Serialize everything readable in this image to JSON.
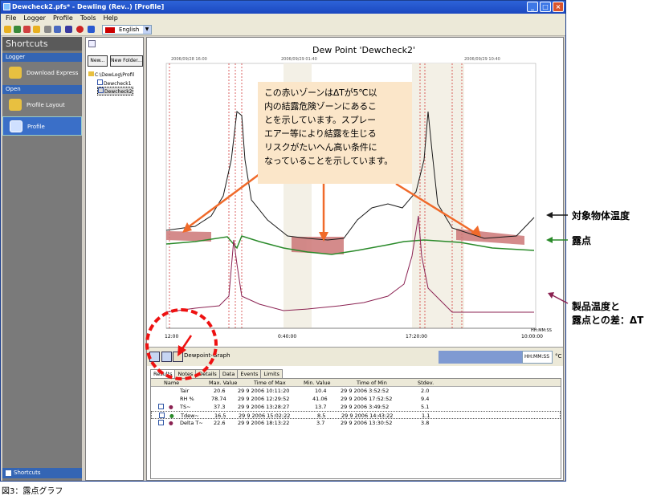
{
  "window": {
    "title": "Dewcheck2.pfs* - Dewling (Rev..) [Profile]"
  },
  "menu": [
    "File",
    "Logger",
    "Profile",
    "Tools",
    "Help"
  ],
  "toolbar": {
    "language": "English"
  },
  "shortcuts": {
    "header": "Shortcuts",
    "sections": [
      {
        "title": "Logger",
        "items": [
          "Download Express"
        ]
      },
      {
        "title": "Open",
        "items": [
          "Profile Layout",
          "Profile"
        ]
      }
    ],
    "footer": "Shortcuts"
  },
  "tree": {
    "new_button": "New...",
    "new_folder_button": "New Folder...",
    "root": "C:\\DewLog\\Profil",
    "children": [
      "Dewcheck1",
      "Dewcheck2"
    ]
  },
  "chart": {
    "title": "Dew Point 'Dewcheck2'",
    "dates": [
      "2006/09/28 16:00",
      "2006/09/29 01:40",
      "2006/09/29 10:40"
    ],
    "x_ticks": [
      "12:00",
      "0:40:00",
      "17:20:00",
      "10:00:00"
    ],
    "x_unit": "HH:MM:SS"
  },
  "callout": {
    "lines": [
      "この赤いゾーンはΔTが5℃以",
      "内の結露危険ゾーンにあるこ",
      "とを示しています。スプレー",
      "エアー等により結露を生じる",
      "リスクがたいへん高い条件に",
      "なっていることを示しています。"
    ]
  },
  "graph_toolbar": {
    "label": "Dewpoint-Graph",
    "format": "HH:MM:SS",
    "unit": "°C"
  },
  "tabs": [
    "Results",
    "Notes",
    "Details",
    "Data",
    "Events",
    "Limits"
  ],
  "table": {
    "headers": [
      "Name",
      "Max. Value",
      "Time of Max",
      "Min. Value",
      "Time of Min",
      "Stdev."
    ],
    "rows": [
      [
        "Tair",
        "20.6",
        "29 9 2006 10:11:20",
        "10.4",
        "29 9 2006 3:52:52",
        "2.0"
      ],
      [
        "RH %",
        "78.74",
        "29 9 2006 12:29:52",
        "41.06",
        "29 9 2006 17:52:52",
        "9.4"
      ],
      [
        "TS~",
        "37.3",
        "29 9 2006 13:28:27",
        "13.7",
        "29 9 2006 3:49:52",
        "5.1"
      ],
      [
        "Tdew~",
        "16.5",
        "29 9 2006 15:02:22",
        "8.5",
        "29 9 2006 14:43:22",
        "1.1"
      ],
      [
        "Delta T~",
        "22.6",
        "29 9 2006 18:13:22",
        "3.7",
        "29 9 2006 13:30:52",
        "3.8"
      ]
    ]
  },
  "legend_labels": {
    "surface": "対象物体温度",
    "dewpoint": "露点",
    "delta_line1": "製品温度と",
    "delta_line2": "露点との差：ΔT"
  },
  "caption": "図3：露点グラフ",
  "colors": {
    "surface": "#1a1a1a",
    "dewpoint": "#2a8a2a",
    "delta": "#8b2252",
    "callout_bg": "#fbe6c9",
    "arrow": "#f06a2a"
  }
}
